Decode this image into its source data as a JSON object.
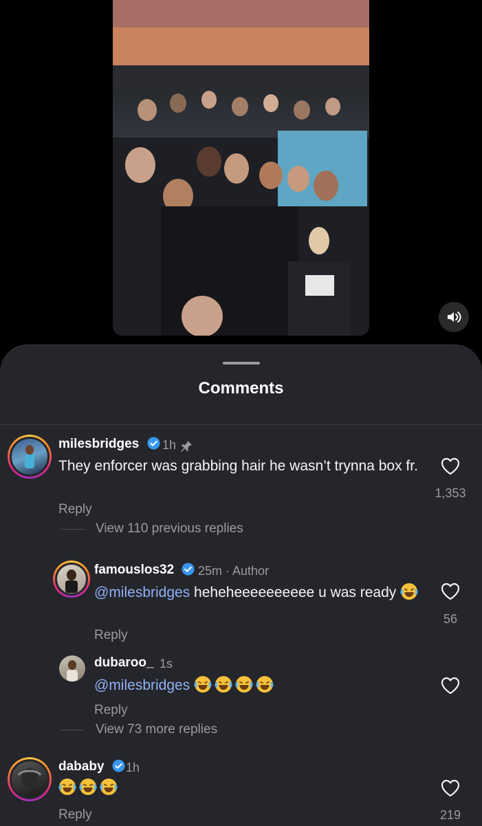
{
  "sheet": {
    "title": "Comments"
  },
  "colors": {
    "mention": "#8fb1f5",
    "verified": "#3897f0",
    "sheet_bg": "#25262b"
  },
  "comments": [
    {
      "username": "milesbridges",
      "time": "1h",
      "pinned": true,
      "text": "They enforcer was grabbing hair he wasn’t trynna box fr.",
      "reply_label": "Reply",
      "likes": "1,353",
      "view_replies": "View 110 previous replies"
    },
    {
      "username": "famouslos32",
      "time": "25m",
      "author_label": "· Author",
      "mention": "@milesbridges",
      "text": "heheheeeeeeeeee u was ready",
      "emoji_count": 1,
      "reply_label": "Reply",
      "likes": "56"
    },
    {
      "username": "dubaroo_",
      "time": "1s",
      "mention": "@milesbridges",
      "emoji_count": 4,
      "reply_label": "Reply",
      "view_replies": "View 73 more replies"
    },
    {
      "username": "dababy",
      "time": "1h",
      "emoji_count": 3,
      "reply_label": "Reply",
      "likes": "219"
    }
  ],
  "icons": {
    "sound": "speaker-icon",
    "verified": "verified-badge-icon",
    "pin": "pin-icon",
    "like": "heart-icon",
    "emoji": "laughing-tears-emoji"
  }
}
